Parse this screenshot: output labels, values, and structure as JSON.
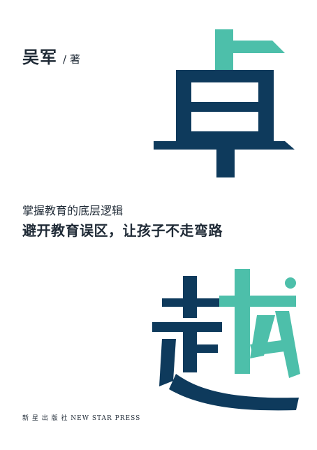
{
  "cover": {
    "author_name": "吴军",
    "author_role": "/ 著",
    "title_char_1": "卓",
    "title_char_2": "越",
    "subtitle_line_1": "掌握教育的底层逻辑",
    "subtitle_line_2": "避开教育误区，让孩子不走弯路",
    "publisher": "新 星 出 版 社   NEW STAR PRESS"
  },
  "colors": {
    "navy": "#0e3a5c",
    "teal": "#4dbfaa",
    "text": "#1f2a36",
    "background": "#ffffff"
  }
}
